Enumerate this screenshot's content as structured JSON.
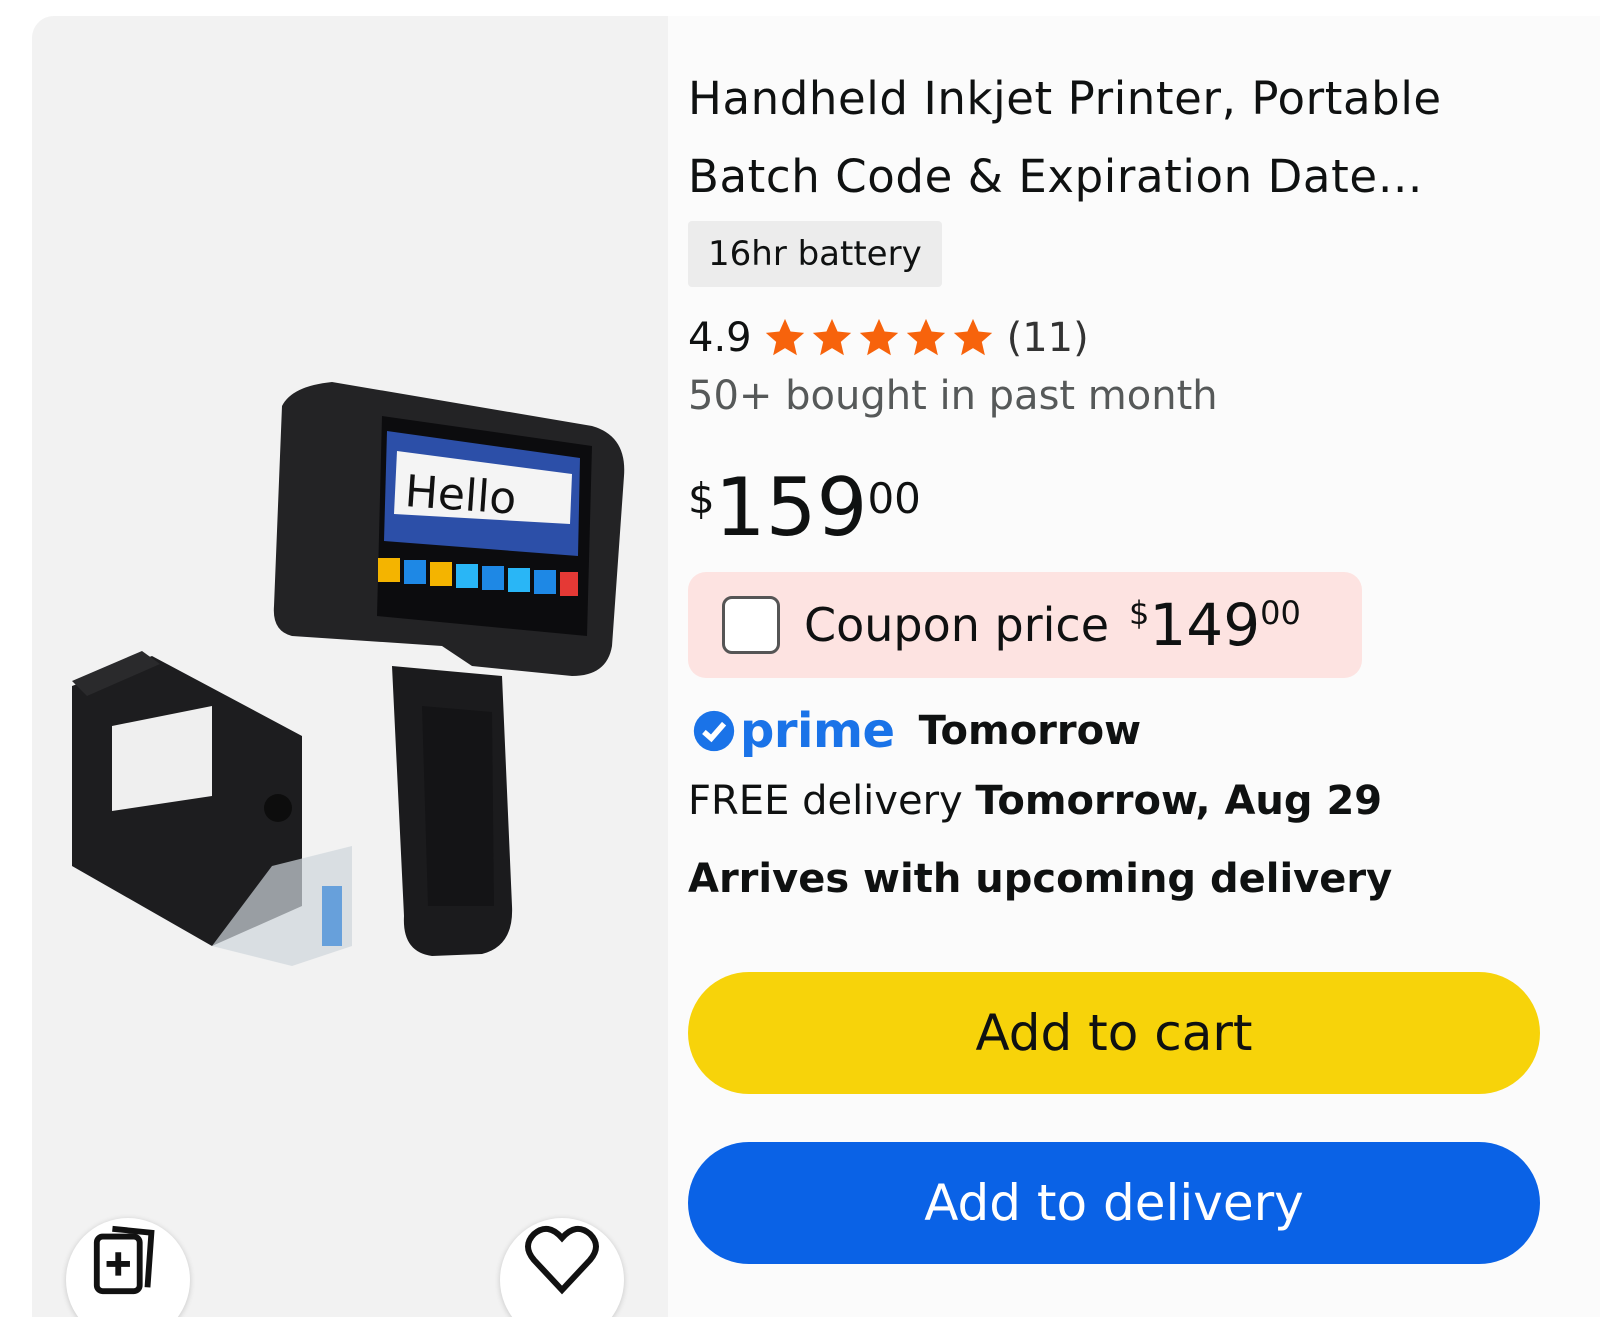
{
  "product": {
    "title_line1": "Handheld Inkjet Printer, Portable",
    "title_line2": "Batch Code & Expiration Date…",
    "badge": "16hr battery",
    "rating": "4.9",
    "rating_count": "(11)",
    "stars_out_of_5": 5,
    "bought": "50+ bought in past month",
    "screen_text": "Hello",
    "price": {
      "symbol": "$",
      "whole": "159",
      "fraction": "00"
    }
  },
  "coupon": {
    "label": "Coupon price",
    "price": {
      "symbol": "$",
      "whole": "149",
      "fraction": "00"
    },
    "checked": false
  },
  "prime": {
    "logo_text": "prime",
    "day": "Tomorrow"
  },
  "delivery": {
    "prefix": "FREE delivery",
    "date": "Tomorrow, Aug 29",
    "arrives": "Arrives with upcoming delivery"
  },
  "actions": {
    "add_to_cart": "Add to cart",
    "add_to_delivery": "Add to delivery"
  },
  "icons": {
    "compare": "compare-cards-icon",
    "wishlist": "heart-icon",
    "prime_check": "check-circle-icon",
    "star": "star-icon"
  },
  "colors": {
    "star": "#f7630c",
    "prime_blue": "#1a73e8",
    "cart_button": "#f7d30a",
    "delivery_button": "#0a62e6",
    "coupon_bg": "#fde3e1"
  }
}
